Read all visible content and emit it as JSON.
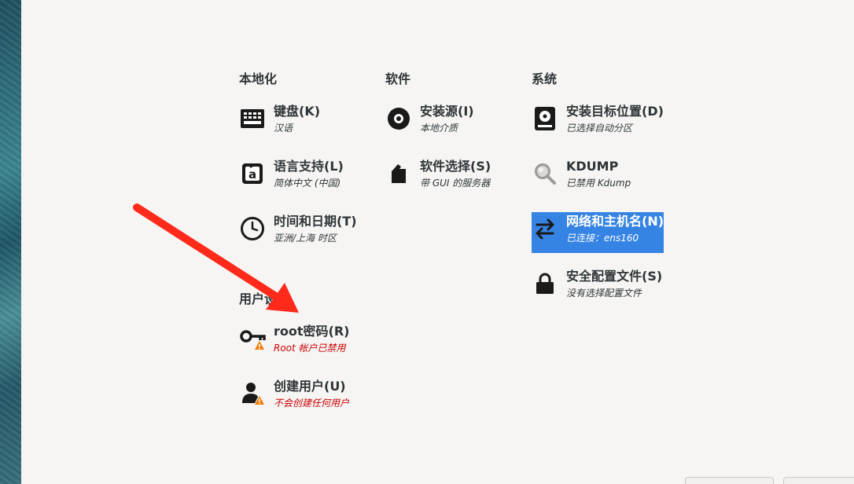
{
  "categories": {
    "localization": {
      "title": "本地化"
    },
    "software": {
      "title": "软件"
    },
    "system": {
      "title": "系统"
    },
    "user": {
      "title": "用户设置"
    }
  },
  "spokes": {
    "keyboard": {
      "title": "键盘(K)",
      "status": "汉语",
      "icon": "keyboard-icon"
    },
    "language": {
      "title": "语言支持(L)",
      "status": "简体中文 (中国)",
      "icon": "language-icon"
    },
    "time": {
      "title": "时间和日期(T)",
      "status": "亚洲/上海 时区",
      "icon": "clock-icon"
    },
    "source": {
      "title": "安装源(I)",
      "status": "本地介质",
      "icon": "disc-icon"
    },
    "software_selection": {
      "title": "软件选择(S)",
      "status": "带 GUI 的服务器",
      "icon": "package-icon"
    },
    "destination": {
      "title": "安装目标位置(D)",
      "status": "已选择自动分区",
      "icon": "harddisk-icon"
    },
    "kdump": {
      "title": "KDUMP",
      "status": "已禁用 Kdump",
      "icon": "magnifier-icon"
    },
    "network": {
      "title": "网络和主机名(N)",
      "status": "已连接：ens160",
      "icon": "network-arrows-icon"
    },
    "security": {
      "title": "安全配置文件(S)",
      "status": "没有选择配置文件",
      "icon": "lock-icon"
    },
    "root": {
      "title": "root密码(R)",
      "status": "Root 帐户已禁用",
      "icon": "key-icon"
    },
    "create_user": {
      "title": "创建用户(U)",
      "status": "不会创建任何用户",
      "icon": "user-icon"
    }
  },
  "colors": {
    "selected_bg": "#3584e4",
    "warning_text": "#cc0000",
    "warning_badge": "#f57900",
    "annotation_arrow": "#ff2a1a"
  }
}
